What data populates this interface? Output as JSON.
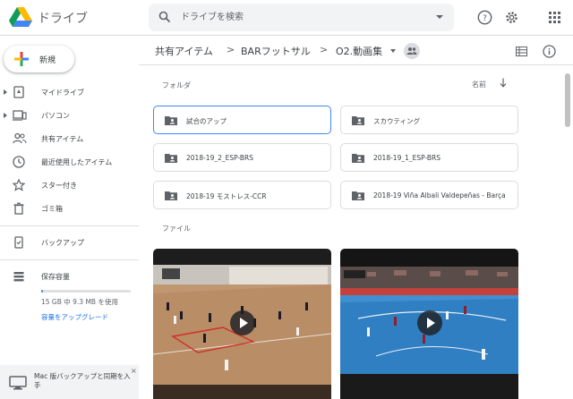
{
  "app": {
    "title": "ドライブ"
  },
  "search": {
    "placeholder": "ドライブを検索"
  },
  "header_icons": [
    "help-icon",
    "settings-icon",
    "apps-icon"
  ],
  "sidebar": {
    "new_label": "新規",
    "items": [
      {
        "label": "マイドライブ",
        "icon": "my-drive-icon",
        "expandable": true
      },
      {
        "label": "パソコン",
        "icon": "computers-icon",
        "expandable": true
      },
      {
        "label": "共有アイテム",
        "icon": "shared-icon",
        "expandable": false
      },
      {
        "label": "最近使用したアイテム",
        "icon": "recent-icon",
        "expandable": false
      },
      {
        "label": "スター付き",
        "icon": "star-icon",
        "expandable": false
      },
      {
        "label": "ゴミ箱",
        "icon": "trash-icon",
        "expandable": false
      }
    ],
    "backup_label": "バックアップ",
    "storage": {
      "label": "保存容量",
      "usage": "15 GB 中 9.3 MB を使用",
      "upgrade": "容量をアップグレード",
      "used_fraction": 0.01
    },
    "promo": {
      "text": "Mac 版バックアップと同期を入手",
      "close": "×"
    }
  },
  "breadcrumb": {
    "items": [
      "共有アイテム",
      "BARフットサル",
      "O2.動画集"
    ],
    "separator": ">"
  },
  "content": {
    "folders_heading": "フォルダ",
    "sort_label": "名前",
    "folders": [
      {
        "name": "試合のアップ",
        "selected": true
      },
      {
        "name": "スカウティング",
        "selected": false
      },
      {
        "name": "2018-19_2_ESP-BRS",
        "selected": false
      },
      {
        "name": "2018-19_1_ESP-BRS",
        "selected": false
      },
      {
        "name": "2018-19 モストレス-CCR",
        "selected": false
      },
      {
        "name": "2018-19 Viña Albali Valdepeñas - Barça",
        "selected": false
      }
    ],
    "files_heading": "ファイル"
  },
  "colors": {
    "accent": "#1a73e8",
    "selected_border": "#4285f4",
    "court_blue": "#2f7fc2"
  }
}
